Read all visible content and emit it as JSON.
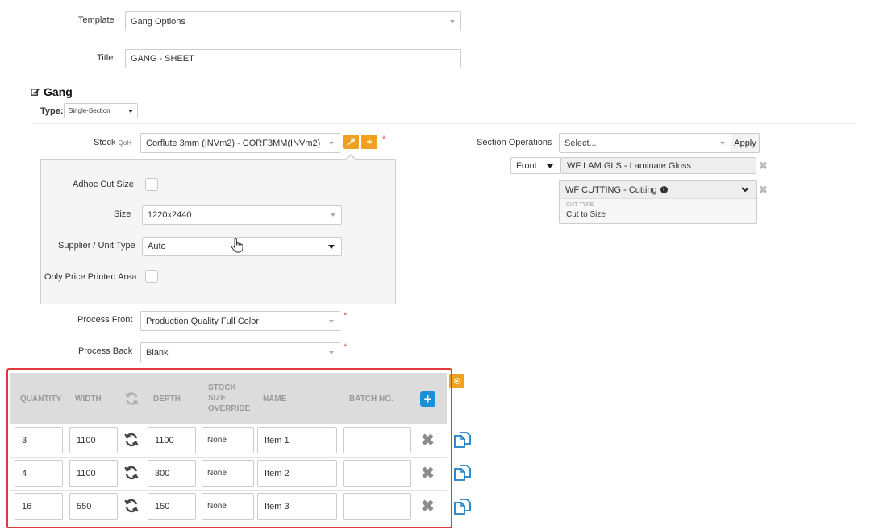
{
  "template": {
    "label": "Template",
    "value": "Gang Options"
  },
  "title_field": {
    "label": "Title",
    "value": "GANG - SHEET"
  },
  "gang": {
    "heading": "Gang",
    "type_label": "Type:",
    "type_value": "Single-Section"
  },
  "stock": {
    "label": "Stock",
    "qoh": "QoH",
    "value": "Corflute 3mm (INVm2) - CORF3MM(INVm2)",
    "add_glyph": "+",
    "required": "*"
  },
  "stock_panel": {
    "adhoc_label": "Adhoc Cut Size",
    "size_label": "Size",
    "size_value": "1220x2440",
    "supplier_label": "Supplier / Unit Type",
    "supplier_value": "Auto",
    "only_price_label": "Only Price Printed Area"
  },
  "process_front": {
    "label": "Process Front",
    "value": "Production Quality Full Color",
    "required": "*"
  },
  "process_back": {
    "label": "Process Back",
    "value": "Blank",
    "required": "*"
  },
  "section_operations": {
    "label": "Section Operations",
    "placeholder": "Select...",
    "apply_label": "Apply",
    "ops": [
      {
        "side": "Front",
        "name": "WF LAM GLS - Laminate Gloss"
      },
      {
        "name": "WF CUTTING - Cutting",
        "sub_label": "CUT TYPE",
        "sub_value": "Cut to Size"
      }
    ],
    "remove_glyph": "✖"
  },
  "table": {
    "headers": {
      "quantity": "QUANTITY",
      "width": "WIDTH",
      "depth": "DEPTH",
      "stock_size_override_1": "STOCK",
      "stock_size_override_2": "SIZE",
      "stock_size_override_3": "OVERRIDE",
      "name": "NAME",
      "batch": "BATCH NO."
    },
    "add_glyph": "+",
    "remove_glyph": "✖",
    "rows": [
      {
        "quantity": "3",
        "width": "1100",
        "depth": "1100",
        "override": "None",
        "name": "Item 1",
        "batch": ""
      },
      {
        "quantity": "4",
        "width": "1100",
        "depth": "300",
        "override": "None",
        "name": "Item 2",
        "batch": ""
      },
      {
        "quantity": "16",
        "width": "550",
        "depth": "150",
        "override": "None",
        "name": "Item 3",
        "batch": ""
      }
    ]
  },
  "colors": {
    "orange": "#f0a023",
    "blue": "#1a8fd6",
    "highlight_red": "#e0393e"
  }
}
